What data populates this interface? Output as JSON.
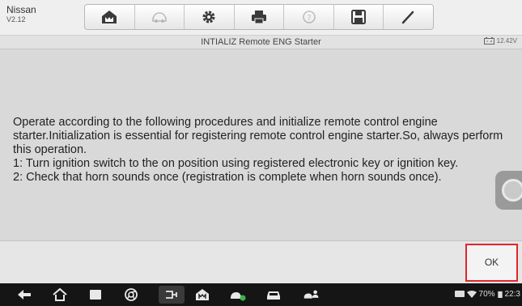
{
  "toolbar": {
    "vehicle_make": "Nissan",
    "version": "V2.12",
    "buttons": [
      "home",
      "vehicle-swap",
      "settings",
      "print",
      "help",
      "save",
      "data-logging"
    ]
  },
  "titlebar": {
    "title": "INTIALIZ Remote ENG Starter",
    "voltage": "12.42V"
  },
  "message": {
    "lines": [
      "Operate according to the following procedures and initialize remote control engine starter.Initialization is essential for registering remote control engine starter.So, always perform this operation.",
      "1: Turn ignition switch to the on position using registered electronic key or ignition key.",
      "2: Check that horn sounds once (registration is complete when horn sounds once)."
    ]
  },
  "buttons": {
    "ok_label": "OK"
  },
  "status_bar": {
    "battery": "70%",
    "time": "22:3"
  },
  "colors": {
    "ok_border": "#e0262b",
    "navbar_bg": "#151515"
  }
}
